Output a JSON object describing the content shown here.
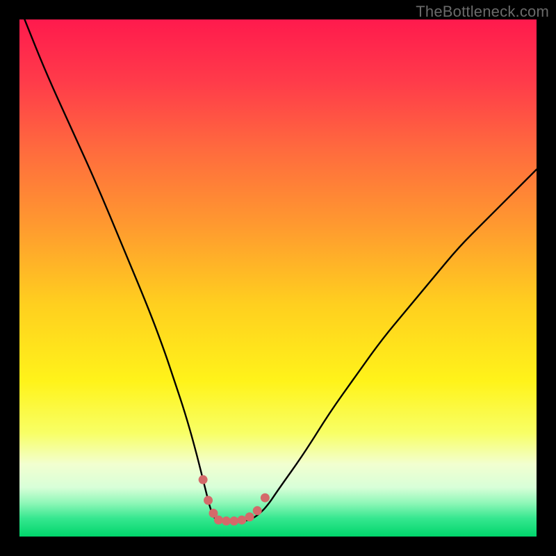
{
  "watermark": "TheBottleneck.com",
  "colors": {
    "frame": "#000000",
    "curve": "#000000",
    "dot_fill": "#d46a6a",
    "gradient_stops": [
      {
        "offset": 0.0,
        "color": "#ff1a4d"
      },
      {
        "offset": 0.12,
        "color": "#ff3b4a"
      },
      {
        "offset": 0.25,
        "color": "#ff6a3e"
      },
      {
        "offset": 0.4,
        "color": "#ff9a2f"
      },
      {
        "offset": 0.55,
        "color": "#ffcf1f"
      },
      {
        "offset": 0.7,
        "color": "#fff31a"
      },
      {
        "offset": 0.8,
        "color": "#f8ff66"
      },
      {
        "offset": 0.86,
        "color": "#f2ffd0"
      },
      {
        "offset": 0.905,
        "color": "#d8ffd8"
      },
      {
        "offset": 0.935,
        "color": "#8ff7b8"
      },
      {
        "offset": 0.965,
        "color": "#35e78f"
      },
      {
        "offset": 1.0,
        "color": "#00d56b"
      }
    ]
  },
  "chart_data": {
    "type": "line",
    "title": "",
    "xlabel": "",
    "ylabel": "",
    "xlim": [
      0,
      100
    ],
    "ylim": [
      0,
      100
    ],
    "note": "Axes are unitless and estimated from pixel positions; the curve is a V-shaped bottleneck curve with a flat minimum region and salmon dots marking the bottom.",
    "series": [
      {
        "name": "bottleneck-curve",
        "x": [
          1,
          5,
          10,
          15,
          20,
          25,
          28,
          30,
          32,
          34,
          36,
          37,
          38,
          40,
          42,
          44,
          46,
          48,
          50,
          55,
          60,
          65,
          70,
          75,
          80,
          85,
          90,
          95,
          100
        ],
        "y": [
          100,
          90,
          79,
          68,
          56,
          44,
          36,
          30,
          24,
          17,
          9,
          5,
          3,
          3,
          3,
          3,
          4,
          6,
          9,
          16,
          24,
          31,
          38,
          44,
          50,
          56,
          61,
          66,
          71
        ]
      }
    ],
    "flat_bottom": {
      "x_start": 37,
      "x_end": 46,
      "y": 3
    },
    "dots": [
      {
        "x": 35.5,
        "y": 11
      },
      {
        "x": 36.5,
        "y": 7
      },
      {
        "x": 37.5,
        "y": 4.5
      },
      {
        "x": 38.5,
        "y": 3.2
      },
      {
        "x": 40.0,
        "y": 3.0
      },
      {
        "x": 41.5,
        "y": 3.0
      },
      {
        "x": 43.0,
        "y": 3.2
      },
      {
        "x": 44.5,
        "y": 3.8
      },
      {
        "x": 46.0,
        "y": 5.0
      },
      {
        "x": 47.5,
        "y": 7.5
      }
    ]
  }
}
